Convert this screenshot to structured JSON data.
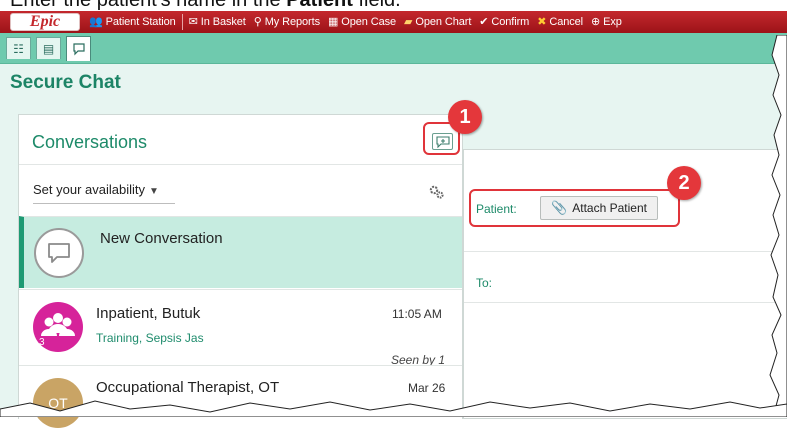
{
  "instruction": {
    "prefix": "Enter the patient's name in the ",
    "bold": "Patient",
    "suffix": " field."
  },
  "toolbar": {
    "logo": "Epic",
    "items": [
      {
        "label": "Patient Station",
        "icon": "patient-station-icon"
      },
      {
        "label": "In Basket",
        "icon": "in-basket-icon"
      },
      {
        "label": "My Reports",
        "icon": "search-icon"
      },
      {
        "label": "Open Case",
        "icon": "grid-icon"
      },
      {
        "label": "Open Chart",
        "icon": "folder-icon"
      },
      {
        "label": "Confirm",
        "icon": "checkmark-icon"
      },
      {
        "label": "Cancel",
        "icon": "x-icon"
      },
      {
        "label": "Exp",
        "icon": "plus-circle-icon"
      }
    ]
  },
  "page": {
    "title": "Secure Chat"
  },
  "conversations": {
    "title": "Conversations",
    "availability": "Set your availability",
    "items": [
      {
        "name": "New Conversation"
      },
      {
        "name": "Inpatient, Butuk",
        "time": "11:05 AM",
        "sub": "Training, Sepsis Jas",
        "seen": "Seen by 1",
        "badge": "3"
      },
      {
        "name": "Occupational Therapist, OT",
        "time": "Mar 26",
        "initials": "OT"
      }
    ]
  },
  "chat": {
    "patient_label": "Patient:",
    "attach_label": "Attach Patient",
    "to_label": "To:"
  },
  "callouts": [
    "1",
    "2"
  ],
  "colors": {
    "epic_red": "#c4282d",
    "tab_teal": "#6fcaae",
    "accent_green": "#1d8a69",
    "callout_red": "#e4373b"
  }
}
